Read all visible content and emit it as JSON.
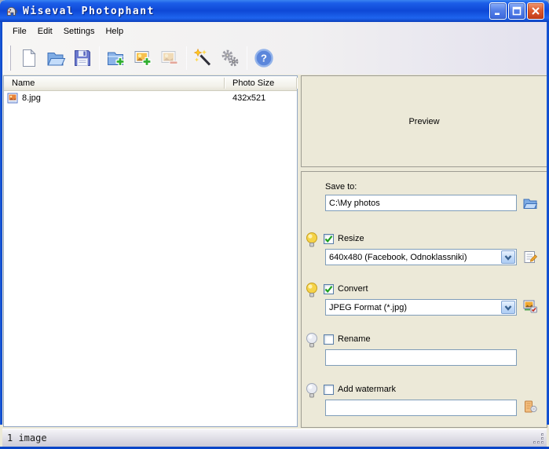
{
  "window": {
    "title": "Wiseval Photophant",
    "controls": {
      "minimize": "minimize",
      "maximize": "maximize",
      "close": "close"
    }
  },
  "menu": {
    "items": [
      {
        "label": "File"
      },
      {
        "label": "Edit"
      },
      {
        "label": "Settings"
      },
      {
        "label": "Help"
      }
    ]
  },
  "toolbar": {
    "buttons": [
      {
        "name": "new-document"
      },
      {
        "name": "open-folder"
      },
      {
        "name": "save"
      },
      {
        "name": "add-folder"
      },
      {
        "name": "add-images"
      },
      {
        "name": "remove-images",
        "disabled": true
      },
      {
        "name": "wizard-wand"
      },
      {
        "name": "settings-gears"
      },
      {
        "name": "help"
      }
    ]
  },
  "file_list": {
    "columns": [
      {
        "label": "Name"
      },
      {
        "label": "Photo Size"
      }
    ],
    "rows": [
      {
        "name": "8.jpg",
        "photo_size": "432x521"
      }
    ]
  },
  "preview": {
    "label": "Preview"
  },
  "options": {
    "save_to": {
      "label": "Save to:",
      "value": "C:\\My photos"
    },
    "resize": {
      "label": "Resize",
      "checked": true,
      "selected": "640x480 (Facebook, Odnoklassniki)"
    },
    "convert": {
      "label": "Convert",
      "checked": true,
      "selected": "JPEG Format (*.jpg)"
    },
    "rename": {
      "label": "Rename",
      "checked": false,
      "value": ""
    },
    "watermark": {
      "label": "Add watermark",
      "checked": false,
      "value": ""
    }
  },
  "status_bar": {
    "text": "1 image"
  },
  "colors": {
    "titlebar_blue": "#1C5EE8",
    "window_border": "#0845C8",
    "panel_face": "#ECE9D8",
    "field_border": "#7F9DB9",
    "check_green": "#1FA01F",
    "close_red": "#C23A18"
  }
}
